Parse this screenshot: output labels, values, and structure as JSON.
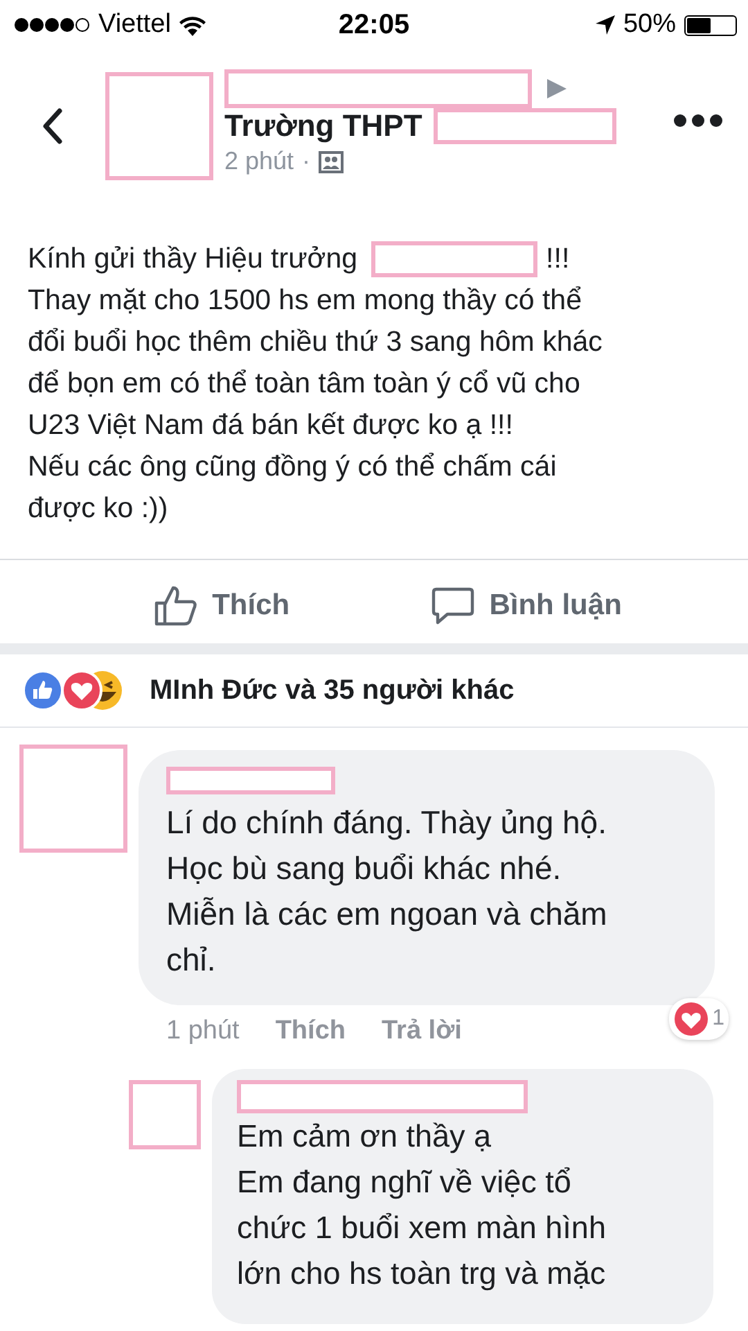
{
  "status_bar": {
    "carrier": "Viettel",
    "time": "22:05",
    "battery": "50%"
  },
  "post": {
    "author_prefix": "Trường THPT",
    "time": "2 phút",
    "separator": "·",
    "intro": "Kính gửi thầy Hiệu trưởng",
    "intro_end": "!!!",
    "lines": [
      "Thay mặt cho 1500 hs em mong thầy có thể",
      "đổi buổi học thêm chiều thứ 3 sang hôm khác",
      "để bọn em có thể toàn tâm toàn ý cổ vũ cho",
      "U23 Việt Nam đá bán kết được ko ạ !!!",
      "Nếu các ông cũng đồng ý có thể chấm cái",
      "được ko :))"
    ]
  },
  "actions": [
    {
      "kind": "like",
      "label": "Thích"
    },
    {
      "kind": "comment",
      "label": "Bình luận"
    }
  ],
  "reactions": {
    "summary": "MInh Đức và 35 người khác"
  },
  "comments": [
    {
      "lines": [
        "Lí do chính đáng. Thày ủng hộ.",
        "Học bù sang buổi khác nhé.",
        "Miễn là các em ngoan và chăm",
        "chỉ."
      ],
      "time": "1 phút",
      "like": "Thích",
      "reply": "Trả lời",
      "reaction_count": "1",
      "replies": [
        {
          "lines": [
            "Em cảm ơn thầy ạ",
            "Em đang nghĩ về việc tổ",
            "chức 1 buổi xem màn hình",
            "lớn cho hs toàn trg và mặc"
          ]
        }
      ]
    }
  ]
}
